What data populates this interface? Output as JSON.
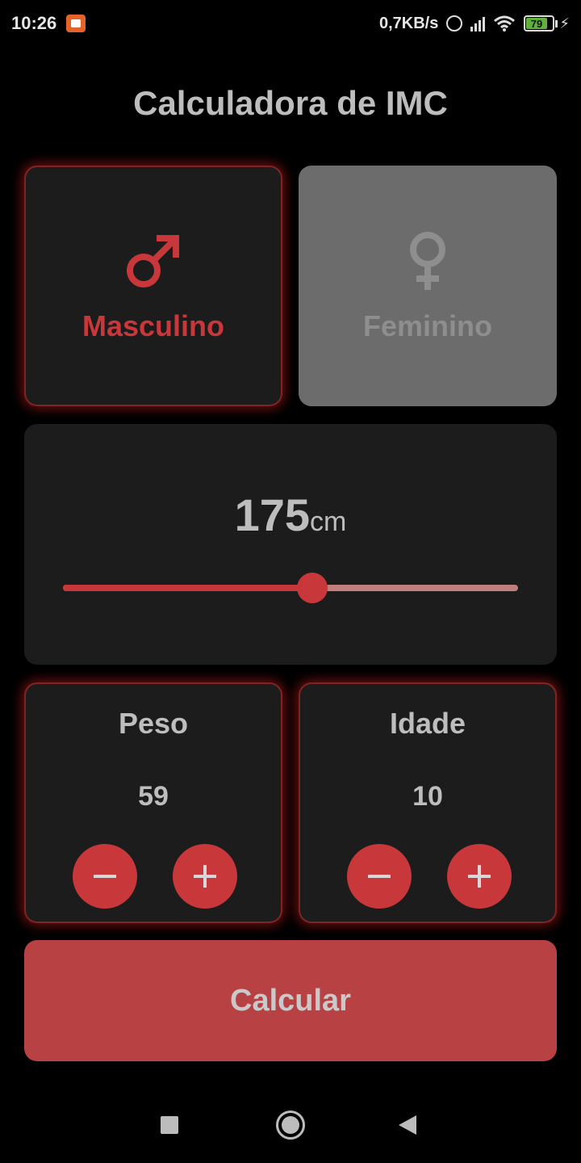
{
  "status_bar": {
    "time": "10:26",
    "net_speed": "0,7KB/s",
    "battery_level": "79",
    "battery_color": "#5fb13a"
  },
  "app": {
    "title": "Calculadora de IMC"
  },
  "gender": {
    "male_label": "Masculino",
    "female_label": "Feminino",
    "selected": "male",
    "male_icon": "male-symbol-icon",
    "female_icon": "female-symbol-icon"
  },
  "height": {
    "value": "175",
    "unit": "cm",
    "slider_fraction": 0.547
  },
  "weight": {
    "label": "Peso",
    "value": "59"
  },
  "age": {
    "label": "Idade",
    "value": "10"
  },
  "action": {
    "calculate_label": "Calcular"
  },
  "colors": {
    "accent": "#c8373a",
    "card_background": "#1b1c1b",
    "unselected_card": "#6b6c6b",
    "button_background": "#b84144"
  }
}
